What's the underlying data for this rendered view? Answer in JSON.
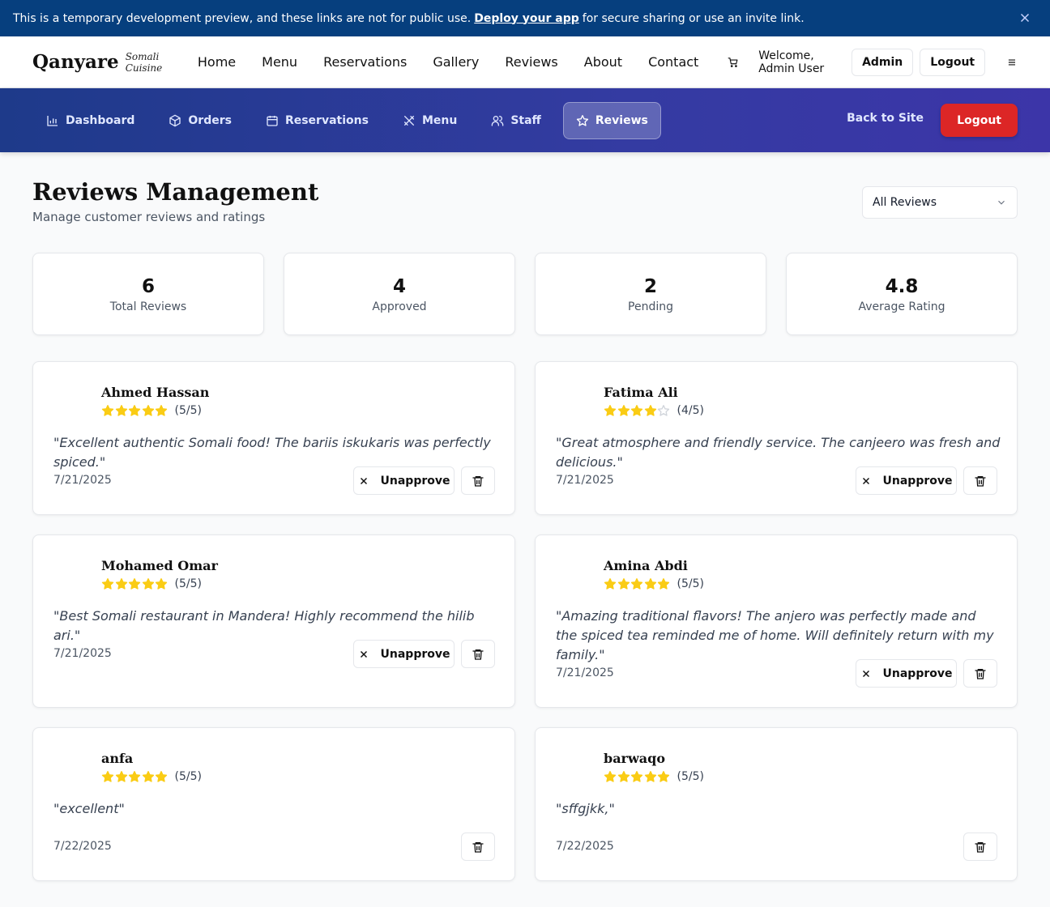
{
  "banner": {
    "text_before": "This is a temporary development preview, and these links are not for public use.",
    "link": "Deploy your app",
    "text_after": "for secure sharing or use an invite link."
  },
  "header": {
    "logo": "Qanyare",
    "logo_sub": "Somali Cuisine",
    "nav": [
      "Home",
      "Menu",
      "Reservations",
      "Gallery",
      "Reviews",
      "About",
      "Contact"
    ],
    "welcome": "Welcome, Admin User",
    "admin_button": "Admin",
    "logout_button": "Logout"
  },
  "admin_nav": {
    "items": [
      {
        "label": "Dashboard",
        "icon": "bar-chart-icon"
      },
      {
        "label": "Orders",
        "icon": "package-icon"
      },
      {
        "label": "Reservations",
        "icon": "calendar-icon"
      },
      {
        "label": "Menu",
        "icon": "utensils-icon"
      },
      {
        "label": "Staff",
        "icon": "users-icon"
      },
      {
        "label": "Reviews",
        "icon": "star-icon",
        "active": true
      }
    ],
    "back_to_site": "Back to Site",
    "logout": "Logout"
  },
  "page": {
    "title": "Reviews Management",
    "subtitle": "Manage customer reviews and ratings",
    "filter": "All Reviews"
  },
  "stats": [
    {
      "value": "6",
      "label": "Total Reviews"
    },
    {
      "value": "4",
      "label": "Approved"
    },
    {
      "value": "2",
      "label": "Pending"
    },
    {
      "value": "4.8",
      "label": "Average Rating"
    }
  ],
  "reviews": [
    {
      "name": "Ahmed Hassan",
      "rating": 5,
      "rating_text": "(5/5)",
      "comment": "\"Excellent authentic Somali food! The bariis iskukaris was perfectly spiced.\"",
      "date": "7/21/2025",
      "action": "Unapprove"
    },
    {
      "name": "Fatima Ali",
      "rating": 4,
      "rating_text": "(4/5)",
      "comment": "\"Great atmosphere and friendly service. The canjeero was fresh and delicious.\"",
      "date": "7/21/2025",
      "action": "Unapprove"
    },
    {
      "name": "Mohamed Omar",
      "rating": 5,
      "rating_text": "(5/5)",
      "comment": "\"Best Somali restaurant in Mandera! Highly recommend the hilib ari.\"",
      "date": "7/21/2025",
      "action": "Unapprove"
    },
    {
      "name": "Amina Abdi",
      "rating": 5,
      "rating_text": "(5/5)",
      "comment": "\"Amazing traditional flavors! The anjero was perfectly made and the spiced tea reminded me of home. Will definitely return with my family.\"",
      "date": "7/21/2025",
      "action": "Unapprove"
    },
    {
      "name": "anfa",
      "rating": 5,
      "rating_text": "(5/5)",
      "comment": "\"excellent\"",
      "date": "7/22/2025",
      "action": ""
    },
    {
      "name": "barwaqo",
      "rating": 5,
      "rating_text": "(5/5)",
      "comment": "\"sffgjkk,\"",
      "date": "7/22/2025",
      "action": ""
    }
  ],
  "colors": {
    "banner": "#063f7e",
    "admin_nav_start": "#1e3a8a",
    "admin_nav_end": "#3c35a8",
    "logout": "#dc2626",
    "star_filled": "#facc15",
    "star_empty": "#d1d5db"
  }
}
